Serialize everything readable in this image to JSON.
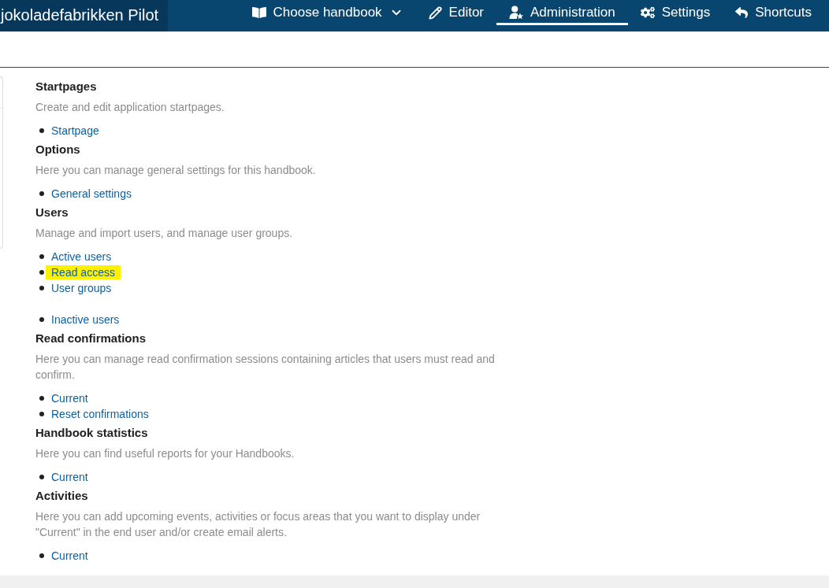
{
  "header": {
    "brand": "jokoladefabrikken Pilot",
    "nav": [
      {
        "label": "Choose handbook",
        "kind": "dropdown",
        "selected": false
      },
      {
        "label": "Editor",
        "kind": "tab",
        "selected": false
      },
      {
        "label": "Administration",
        "kind": "tab",
        "selected": true
      },
      {
        "label": "Settings",
        "kind": "tab",
        "selected": false
      },
      {
        "label": "Shortcuts",
        "kind": "tab",
        "selected": false
      }
    ]
  },
  "sections": [
    {
      "title": "Startpages",
      "description": "Create and edit application startpages.",
      "link_groups": [
        [
          {
            "label": "Startpage",
            "highlighted": false
          }
        ]
      ]
    },
    {
      "title": "Options",
      "description": "Here you can manage general settings for this handbook.",
      "link_groups": [
        [
          {
            "label": "General settings",
            "highlighted": false
          }
        ]
      ]
    },
    {
      "title": "Users",
      "description": "Manage and import users, and manage user groups.",
      "link_groups": [
        [
          {
            "label": "Active users",
            "highlighted": false
          },
          {
            "label": "Read access",
            "highlighted": true
          },
          {
            "label": "User groups",
            "highlighted": false
          }
        ],
        [
          {
            "label": "Inactive users",
            "highlighted": false
          }
        ]
      ]
    },
    {
      "title": "Read confirmations",
      "description": "Here you can manage read confirmation sessions containing articles that users must read and confirm.",
      "link_groups": [
        [
          {
            "label": "Current",
            "highlighted": false
          },
          {
            "label": "Reset confirmations",
            "highlighted": false
          }
        ]
      ]
    },
    {
      "title": "Handbook statistics",
      "description": "Here you can find useful reports for your Handbooks.",
      "link_groups": [
        [
          {
            "label": "Current",
            "highlighted": false
          }
        ]
      ]
    },
    {
      "title": "Activities",
      "description": "Here you can add upcoming events, activities or focus areas that you want to display under \"Current\" in the end user and/or create email alerts.",
      "link_groups": [
        [
          {
            "label": "Current",
            "highlighted": false
          }
        ]
      ]
    }
  ]
}
